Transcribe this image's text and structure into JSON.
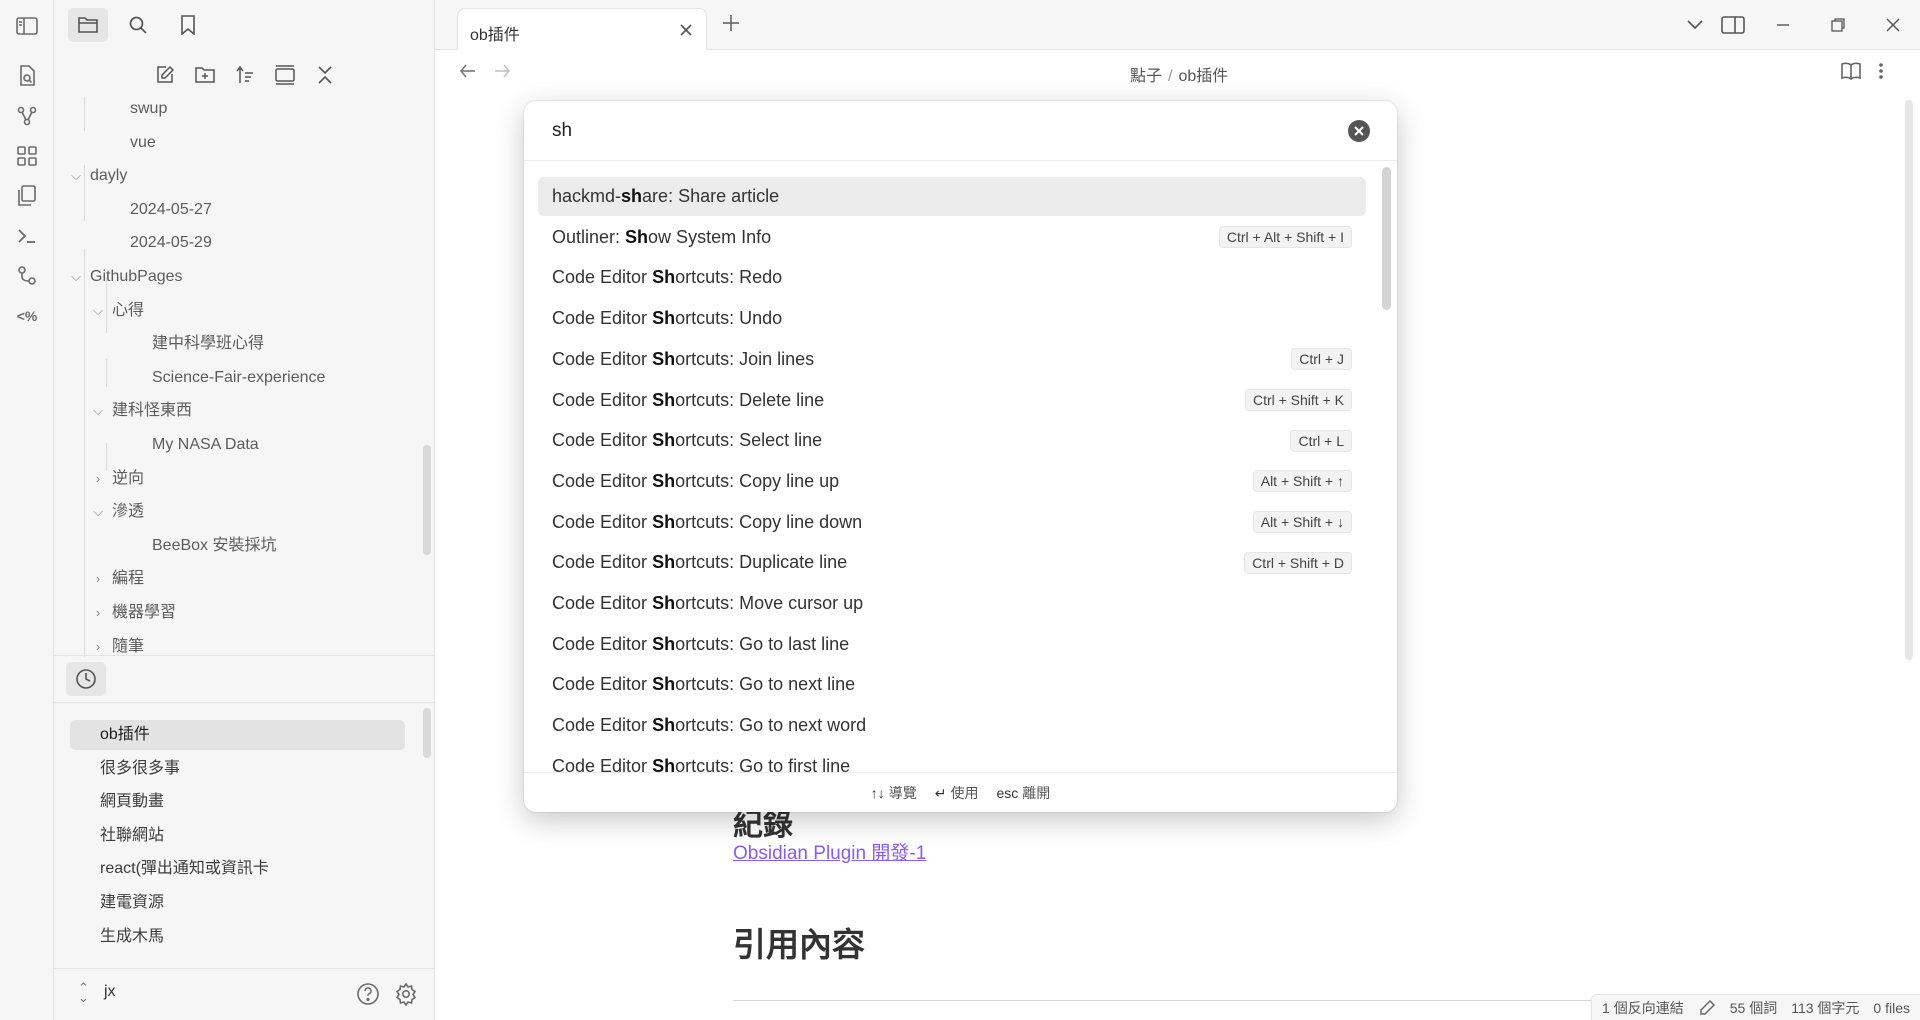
{
  "tab": {
    "title": "ob插件"
  },
  "breadcrumb": {
    "parent": "點子",
    "separator": "/",
    "current": "ob插件"
  },
  "file_tree": [
    {
      "label": "swup",
      "depth": 2,
      "type": "file"
    },
    {
      "label": "vue",
      "depth": 2,
      "type": "file"
    },
    {
      "label": "dayly",
      "depth": 1,
      "type": "folder-open"
    },
    {
      "label": "2024-05-27",
      "depth": 2,
      "type": "file"
    },
    {
      "label": "2024-05-29",
      "depth": 2,
      "type": "file"
    },
    {
      "label": "GithubPages",
      "depth": 1,
      "type": "folder-open"
    },
    {
      "label": "心得",
      "depth": 2,
      "type": "folder-open"
    },
    {
      "label": "建中科學班心得",
      "depth": 3,
      "type": "file"
    },
    {
      "label": "Science-Fair-experience",
      "depth": 3,
      "type": "file"
    },
    {
      "label": "建科怪東西",
      "depth": 2,
      "type": "folder-open"
    },
    {
      "label": "My NASA Data",
      "depth": 3,
      "type": "file"
    },
    {
      "label": "逆向",
      "depth": 2,
      "type": "folder-closed"
    },
    {
      "label": "滲透",
      "depth": 2,
      "type": "folder-open"
    },
    {
      "label": "BeeBox 安裝採坑",
      "depth": 3,
      "type": "file"
    },
    {
      "label": "編程",
      "depth": 2,
      "type": "folder-closed"
    },
    {
      "label": "機器學習",
      "depth": 2,
      "type": "folder-closed"
    },
    {
      "label": "隨筆",
      "depth": 2,
      "type": "folder-closed"
    }
  ],
  "recent_files": [
    {
      "label": "ob插件",
      "active": true
    },
    {
      "label": "很多很多事"
    },
    {
      "label": "網頁動畫"
    },
    {
      "label": "社聯網站"
    },
    {
      "label": "react(彈出通知或資訊卡"
    },
    {
      "label": "建電資源"
    },
    {
      "label": "生成木馬"
    },
    {
      "label": "...."
    }
  ],
  "vault": {
    "name": "jx"
  },
  "document": {
    "partial_heading": "紀錄",
    "link": "Obsidian Plugin 開發-1",
    "heading": "引用內容"
  },
  "palette": {
    "query": "sh",
    "items": [
      {
        "prefix": "hackmd-",
        "match": "sh",
        "suffix": "are: Share article",
        "hotkey": "",
        "selected": true
      },
      {
        "prefix": "Outliner: ",
        "match": "Sh",
        "suffix": "ow System Info",
        "hotkey": "Ctrl + Alt + Shift + I"
      },
      {
        "prefix": "Code Editor ",
        "match": "Sh",
        "suffix": "ortcuts: Redo",
        "hotkey": ""
      },
      {
        "prefix": "Code Editor ",
        "match": "Sh",
        "suffix": "ortcuts: Undo",
        "hotkey": ""
      },
      {
        "prefix": "Code Editor ",
        "match": "Sh",
        "suffix": "ortcuts: Join lines",
        "hotkey": "Ctrl + J"
      },
      {
        "prefix": "Code Editor ",
        "match": "Sh",
        "suffix": "ortcuts: Delete line",
        "hotkey": "Ctrl + Shift + K"
      },
      {
        "prefix": "Code Editor ",
        "match": "Sh",
        "suffix": "ortcuts: Select line",
        "hotkey": "Ctrl + L"
      },
      {
        "prefix": "Code Editor ",
        "match": "Sh",
        "suffix": "ortcuts: Copy line up",
        "hotkey": "Alt + Shift + ↑"
      },
      {
        "prefix": "Code Editor ",
        "match": "Sh",
        "suffix": "ortcuts: Copy line down",
        "hotkey": "Alt + Shift + ↓"
      },
      {
        "prefix": "Code Editor ",
        "match": "Sh",
        "suffix": "ortcuts: Duplicate line",
        "hotkey": "Ctrl + Shift + D"
      },
      {
        "prefix": "Code Editor ",
        "match": "Sh",
        "suffix": "ortcuts: Move cursor up",
        "hotkey": ""
      },
      {
        "prefix": "Code Editor ",
        "match": "Sh",
        "suffix": "ortcuts: Go to last line",
        "hotkey": ""
      },
      {
        "prefix": "Code Editor ",
        "match": "Sh",
        "suffix": "ortcuts: Go to next line",
        "hotkey": ""
      },
      {
        "prefix": "Code Editor ",
        "match": "Sh",
        "suffix": "ortcuts: Go to next word",
        "hotkey": ""
      },
      {
        "prefix": "Code Editor ",
        "match": "Sh",
        "suffix": "ortcuts: Go to first line",
        "hotkey": ""
      }
    ],
    "footer": {
      "navigate_key": "↑↓",
      "navigate_label": "導覽",
      "use_key": "↵",
      "use_label": "使用",
      "esc_key": "esc",
      "esc_label": "離開"
    }
  },
  "status_bar": {
    "backlinks": "1 個反向連結",
    "words": "55 個詞",
    "chars": "113 個字元",
    "files": "0 files"
  },
  "colors": {
    "accent_link": "#8a5cf5",
    "sidebar_bg": "#f6f6f6",
    "selected_bg": "#ececec"
  }
}
